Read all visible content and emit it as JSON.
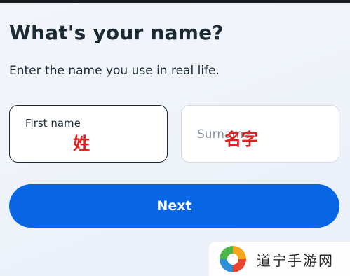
{
  "heading": {
    "title": "What's your name?",
    "subtitle": "Enter the name you use in real life."
  },
  "form": {
    "first_name": {
      "label": "First name",
      "annotation": "姓"
    },
    "surname": {
      "placeholder": "Surname",
      "annotation": "名字"
    }
  },
  "actions": {
    "next_label": "Next"
  },
  "watermark": {
    "text": "道宁手游网"
  },
  "colors": {
    "primary": "#0865e3",
    "text": "#1c2b33",
    "annotation": "#e1221f"
  }
}
